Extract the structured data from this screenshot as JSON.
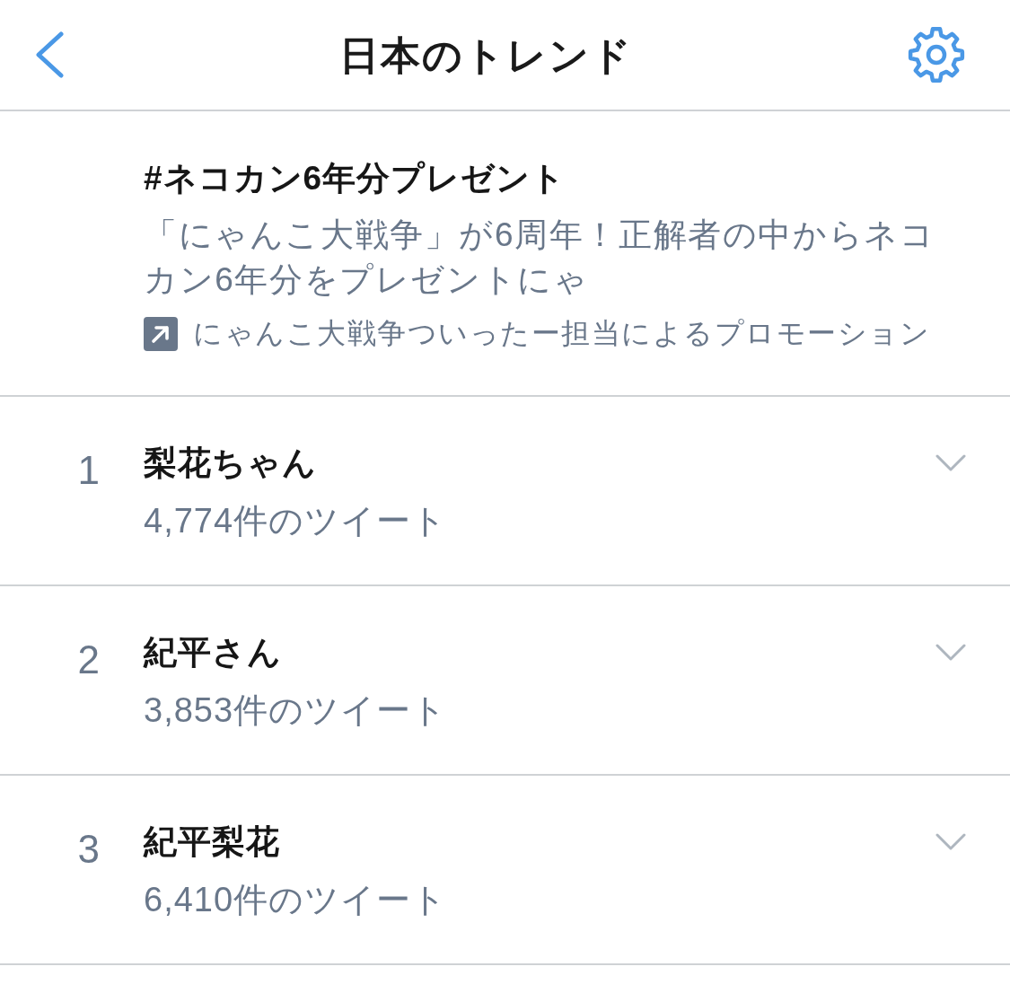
{
  "header": {
    "title": "日本のトレンド"
  },
  "promoted": {
    "title": "#ネコカン6年分プレゼント",
    "description": "「にゃんこ大戦争」が6周年！正解者の中からネコカン6年分をプレゼントにゃ",
    "promoter": "にゃんこ大戦争ついったー担当によるプロモーション"
  },
  "trends": [
    {
      "rank": "1",
      "name": "梨花ちゃん",
      "count": "4,774件のツイート"
    },
    {
      "rank": "2",
      "name": "紀平さん",
      "count": "3,853件のツイート"
    },
    {
      "rank": "3",
      "name": "紀平梨花",
      "count": "6,410件のツイート"
    }
  ]
}
